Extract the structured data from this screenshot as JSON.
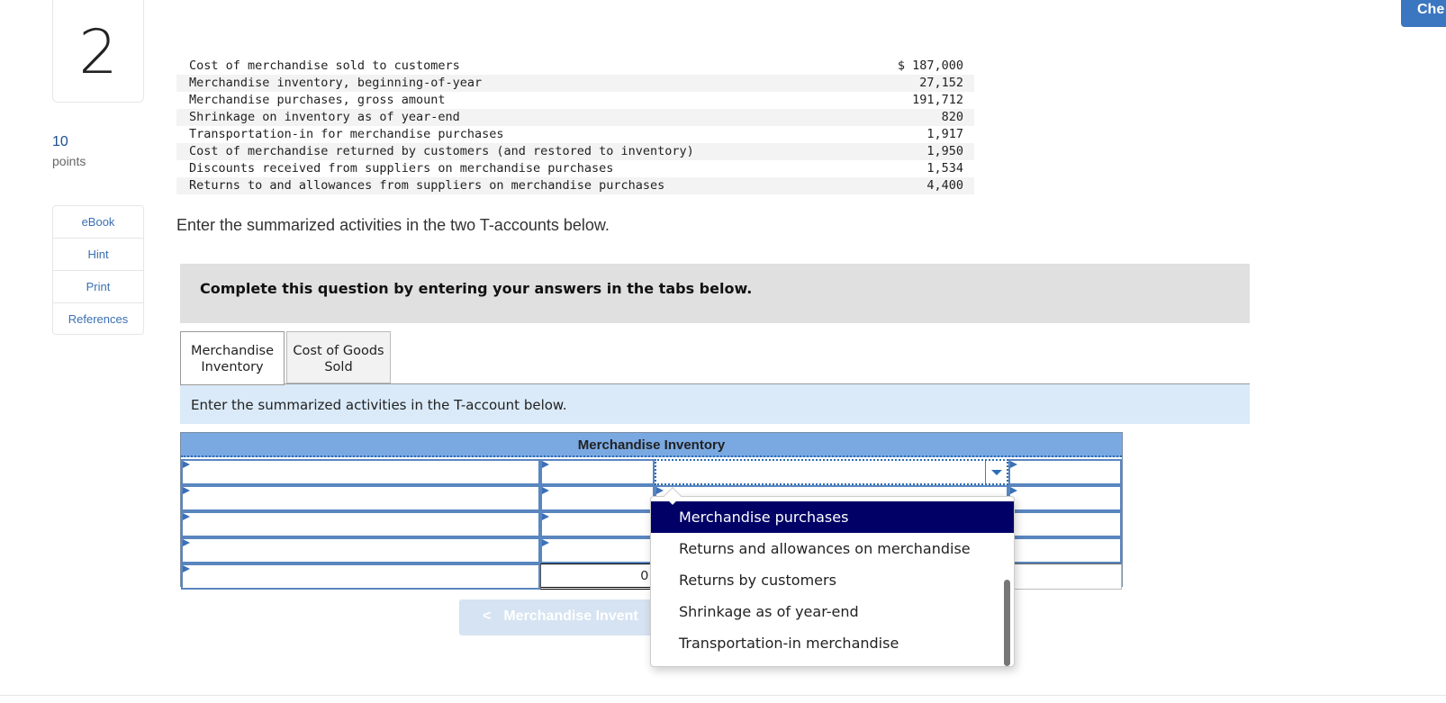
{
  "question": {
    "number": "2",
    "points_value": "10",
    "points_label": "points"
  },
  "header": {
    "check_button_label": "Che"
  },
  "side_links": [
    {
      "label": "eBook"
    },
    {
      "label": "Hint"
    },
    {
      "label": "Print"
    },
    {
      "label": "References"
    }
  ],
  "data_table": [
    {
      "label": "Cost of merchandise sold to customers",
      "amount": "$ 187,000"
    },
    {
      "label": "Merchandise inventory, beginning-of-year",
      "amount": "27,152"
    },
    {
      "label": "Merchandise purchases, gross amount",
      "amount": "191,712"
    },
    {
      "label": "Shrinkage on inventory as of year-end",
      "amount": "820"
    },
    {
      "label": "Transportation-in for merchandise purchases",
      "amount": "1,917"
    },
    {
      "label": "Cost of merchandise returned by customers (and restored to inventory)",
      "amount": "1,950"
    },
    {
      "label": "Discounts received from suppliers on merchandise purchases",
      "amount": "1,534"
    },
    {
      "label": "Returns to and allowances from suppliers on merchandise purchases",
      "amount": "4,400"
    }
  ],
  "instruction": "Enter the summarized activities in the two T-accounts below.",
  "banner": "Complete this question by entering your answers in the tabs below.",
  "tabs": [
    {
      "label": "Merchandise Inventory",
      "active": true
    },
    {
      "label": "Cost of Goods Sold",
      "active": false
    }
  ],
  "tab_instruction": "Enter the summarized activities in the T-account below.",
  "taccount": {
    "title": "Merchandise Inventory",
    "left_total": "0"
  },
  "dropdown": {
    "options": [
      {
        "label": "Merchandise purchases",
        "selected": true
      },
      {
        "label": "Returns and allowances on merchandise",
        "selected": false
      },
      {
        "label": "Returns by customers",
        "selected": false
      },
      {
        "label": "Shrinkage as of year-end",
        "selected": false
      },
      {
        "label": "Transportation-in merchandise",
        "selected": false
      }
    ]
  },
  "nav": {
    "prev_label": "Merchandise Invent",
    "prev_icon": "chevron-left-icon"
  },
  "colors": {
    "accent_blue": "#3b76c0",
    "taccount_header": "#7aa9e2",
    "selected_option": "#000066",
    "banner_gray": "#e0e0e0",
    "banner_blue": "#daeaf8"
  }
}
